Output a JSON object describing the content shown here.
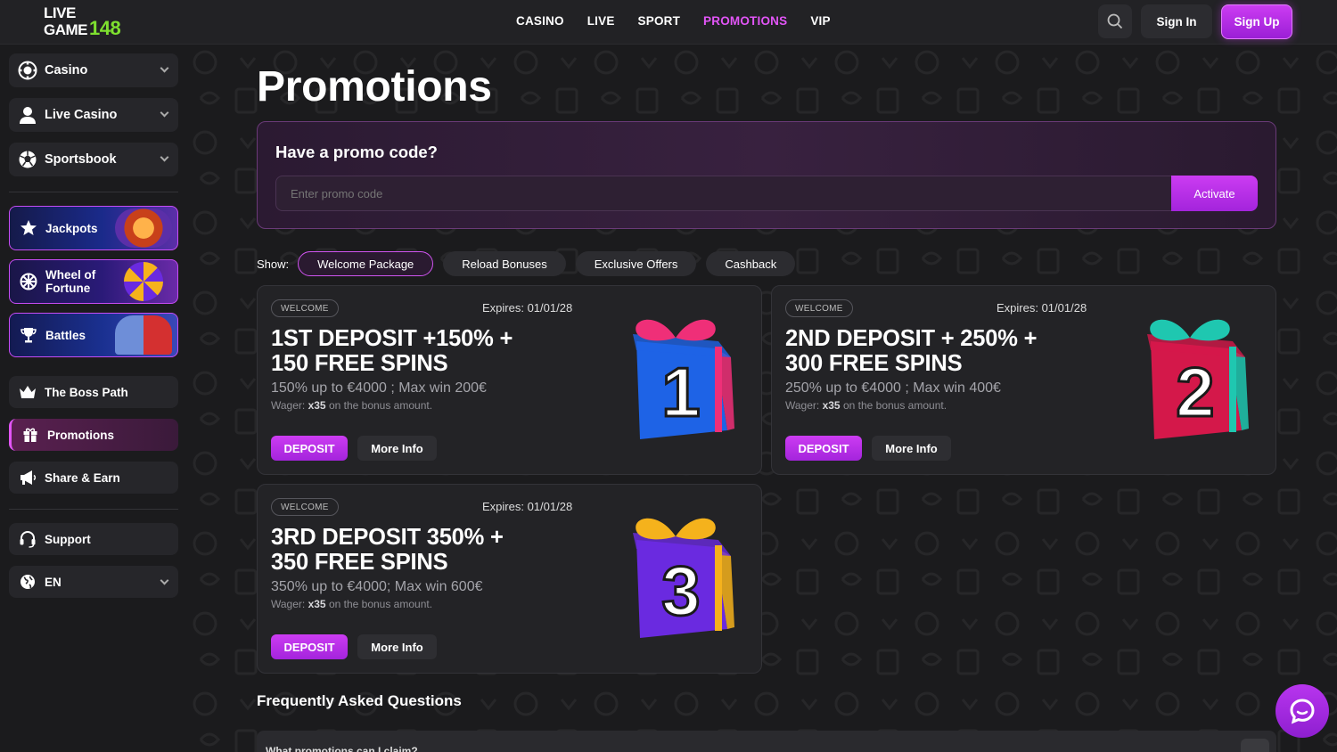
{
  "header": {
    "logo_line1": "LIVE",
    "logo_line2": "GAME",
    "logo_number": "148",
    "nav": [
      "CASINO",
      "LIVE",
      "SPORT",
      "PROMOTIONS",
      "VIP"
    ],
    "active_nav": "PROMOTIONS",
    "signin_label": "Sign In",
    "signup_label": "Sign Up"
  },
  "sidebar": {
    "main_items": [
      {
        "label": "Casino",
        "icon": "casino-chip-icon"
      },
      {
        "label": "Live Casino",
        "icon": "person-icon"
      },
      {
        "label": "Sportsbook",
        "icon": "soccer-ball-icon"
      }
    ],
    "featured": [
      {
        "label": "Jackpots",
        "icon": "star-icon"
      },
      {
        "label_line1": "Wheel of",
        "label_line2": "Fortune",
        "icon": "wheel-icon"
      },
      {
        "label": "Battles",
        "icon": "trophy-icon"
      }
    ],
    "links": [
      {
        "label": "The Boss Path",
        "icon": "crown-icon"
      },
      {
        "label": "Promotions",
        "icon": "gift-icon"
      },
      {
        "label": "Share & Earn",
        "icon": "megaphone-icon"
      }
    ],
    "support_label": "Support",
    "language_label": "EN"
  },
  "page": {
    "title": "Promotions",
    "promo_heading": "Have a promo code?",
    "promo_placeholder": "Enter promo code",
    "activate_label": "Activate",
    "show_label": "Show:",
    "filters": [
      "Welcome Package",
      "Reload Bonuses",
      "Exclusive Offers",
      "Cashback"
    ],
    "active_filter": "Welcome Package"
  },
  "promos": [
    {
      "tag": "WELCOME",
      "expires": "Expires: 01/01/28",
      "headline_1": "1ST DEPOSIT +150% +",
      "headline_2": "150 FREE SPINS",
      "subtitle": "150% up to €4000 ; Max win 200€",
      "wager_prefix": "Wager: ",
      "wager_value": "x35",
      "wager_suffix": " on the bonus amount.",
      "deposit_label": "DEPOSIT",
      "more_label": "More Info",
      "gift_number": "1",
      "box_color": "#1e63e6",
      "ribbon_color": "#ef2f78"
    },
    {
      "tag": "WELCOME",
      "expires": "Expires: 01/01/28",
      "headline_1": "2ND DEPOSIT + 250% +",
      "headline_2": "300 FREE SPINS",
      "subtitle": "250% up to €4000 ; Max win 400€",
      "wager_prefix": "Wager: ",
      "wager_value": "x35",
      "wager_suffix": " on the bonus amount.",
      "deposit_label": "DEPOSIT",
      "more_label": "More Info",
      "gift_number": "2",
      "box_color": "#d4184a",
      "ribbon_color": "#1fc7b0"
    },
    {
      "tag": "WELCOME",
      "expires": "Expires: 01/01/28",
      "headline_1": "3RD DEPOSIT 350% +",
      "headline_2": "350 FREE SPINS",
      "subtitle": "350% up to €4000; Max win 600€",
      "wager_prefix": "Wager: ",
      "wager_value": "x35",
      "wager_suffix": " on the bonus amount.",
      "deposit_label": "DEPOSIT",
      "more_label": "More Info",
      "gift_number": "3",
      "box_color": "#6a2ae0",
      "ribbon_color": "#f5b21c"
    }
  ],
  "faq": {
    "title": "Frequently Asked Questions",
    "first_question": "What promotions can I claim?"
  },
  "colors": {
    "accent": "#e255f7",
    "logo_green": "#7ee02f",
    "background": "#1b1b1d"
  }
}
